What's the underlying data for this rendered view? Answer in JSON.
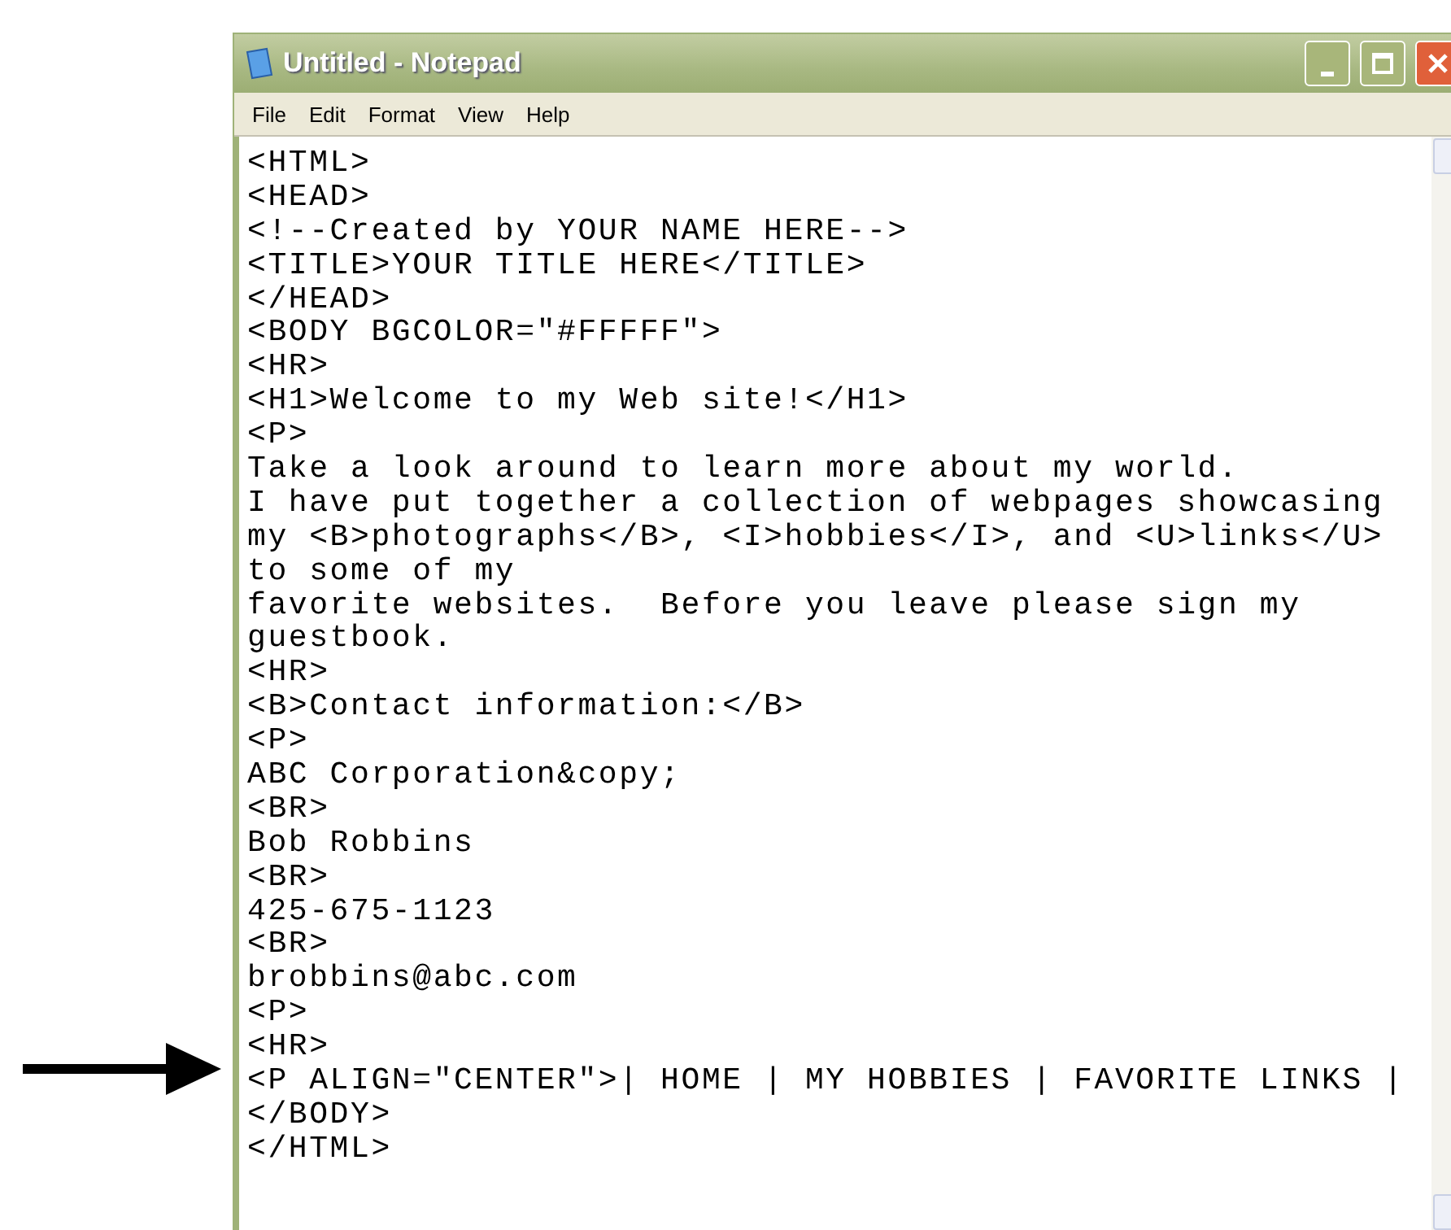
{
  "window": {
    "title": "Untitled - Notepad"
  },
  "menu": [
    "File",
    "Edit",
    "Format",
    "View",
    "Help"
  ],
  "editor": {
    "lines": [
      "<HTML>",
      "<HEAD>",
      "<!--Created by YOUR NAME HERE-->",
      "<TITLE>YOUR TITLE HERE</TITLE>",
      "</HEAD>",
      "<BODY BGCOLOR=\"#FFFFF\">",
      "<HR>",
      "<H1>Welcome to my Web site!</H1>",
      "<P>",
      "Take a look around to learn more about my world.",
      "I have put together a collection of webpages showcasing",
      "my <B>photographs</B>, <I>hobbies</I>, and <U>links</U>",
      "to some of my",
      "favorite websites.  Before you leave please sign my",
      "guestbook.",
      "<HR>",
      "<B>Contact information:</B>",
      "<P>",
      "ABC Corporation&copy;",
      "<BR>",
      "Bob Robbins",
      "<BR>",
      "425-675-1123",
      "<BR>",
      "brobbins@abc.com",
      "<P>",
      "<HR>",
      "<P ALIGN=\"CENTER\">| HOME | MY HOBBIES | FAVORITE LINKS |",
      "</BODY>",
      "</HTML>"
    ]
  }
}
